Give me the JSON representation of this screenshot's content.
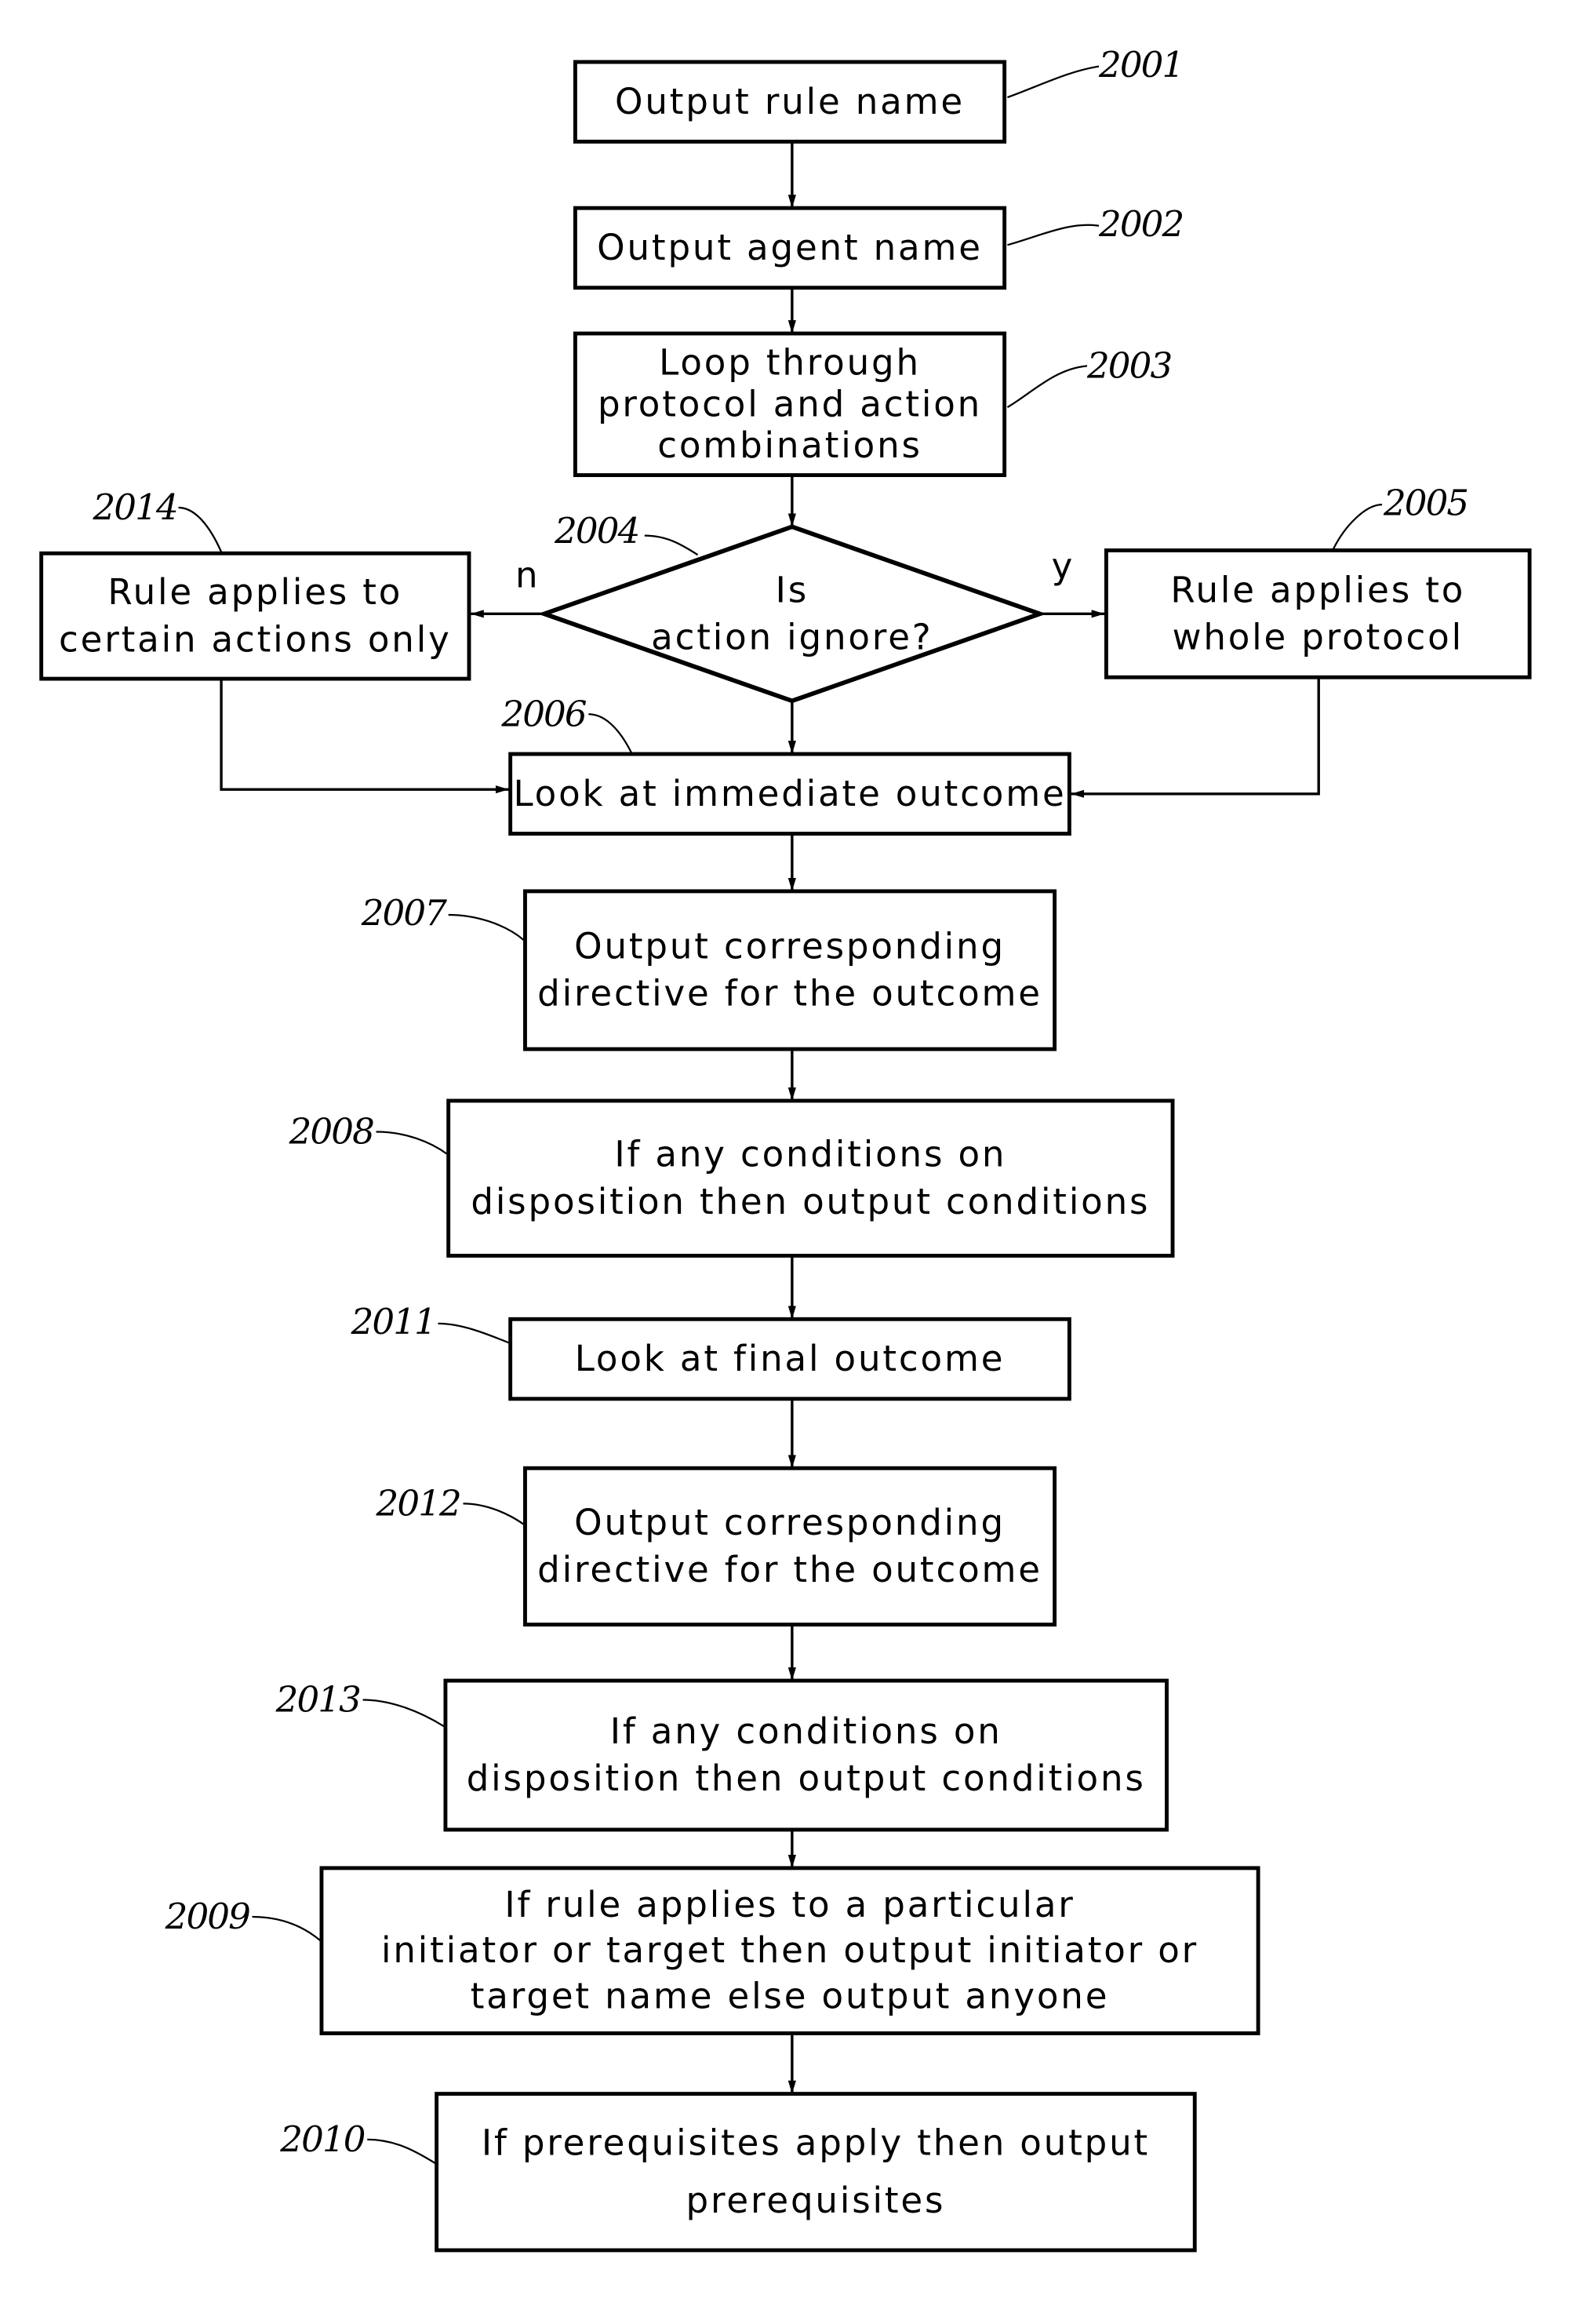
{
  "figure": {
    "type": "flowchart",
    "nodes": [
      {
        "id": "2001",
        "ref": "2001",
        "shape": "process",
        "lines": [
          "Output  rule  name"
        ]
      },
      {
        "id": "2002",
        "ref": "2002",
        "shape": "process",
        "lines": [
          "Output  agent  name"
        ]
      },
      {
        "id": "2003",
        "ref": "2003",
        "shape": "process",
        "lines": [
          "Loop  through",
          "protocol  and  action",
          "combinations"
        ]
      },
      {
        "id": "2004",
        "ref": "2004",
        "shape": "decision",
        "lines": [
          "Is",
          "action  ignore?"
        ]
      },
      {
        "id": "2014",
        "ref": "2014",
        "shape": "process",
        "lines": [
          "Rule  applies  to",
          "certain  actions  only"
        ]
      },
      {
        "id": "2005",
        "ref": "2005",
        "shape": "process",
        "lines": [
          "Rule  applies  to",
          "whole  protocol"
        ]
      },
      {
        "id": "2006",
        "ref": "2006",
        "shape": "process",
        "lines": [
          "Look  at  immediate  outcome"
        ]
      },
      {
        "id": "2007",
        "ref": "2007",
        "shape": "process",
        "lines": [
          "Output  corresponding",
          "directive  for  the  outcome"
        ]
      },
      {
        "id": "2008",
        "ref": "2008",
        "shape": "process",
        "lines": [
          "If  any  conditions  on",
          "disposition  then  output  conditions"
        ]
      },
      {
        "id": "2011",
        "ref": "2011",
        "shape": "process",
        "lines": [
          "Look  at  final  outcome"
        ]
      },
      {
        "id": "2012",
        "ref": "2012",
        "shape": "process",
        "lines": [
          "Output  corresponding",
          "directive  for  the  outcome"
        ]
      },
      {
        "id": "2013",
        "ref": "2013",
        "shape": "process",
        "lines": [
          "If  any  conditions  on",
          "disposition  then  output  conditions"
        ]
      },
      {
        "id": "2009",
        "ref": "2009",
        "shape": "process",
        "lines": [
          "If  rule  applies  to  a  particular",
          "initiator  or  target  then  output  initiator  or",
          "target  name  else  output  anyone"
        ]
      },
      {
        "id": "2010",
        "ref": "2010",
        "shape": "process",
        "lines": [
          "If  prerequisites  apply  then  output",
          "prerequisites"
        ]
      }
    ],
    "edges": [
      {
        "from": "2001",
        "to": "2002",
        "label": ""
      },
      {
        "from": "2002",
        "to": "2003",
        "label": ""
      },
      {
        "from": "2003",
        "to": "2004",
        "label": ""
      },
      {
        "from": "2004",
        "to": "2014",
        "label": "n"
      },
      {
        "from": "2004",
        "to": "2005",
        "label": "y"
      },
      {
        "from": "2004",
        "to": "2006",
        "label": ""
      },
      {
        "from": "2014",
        "to": "2006",
        "label": ""
      },
      {
        "from": "2005",
        "to": "2006",
        "label": ""
      },
      {
        "from": "2006",
        "to": "2007",
        "label": ""
      },
      {
        "from": "2007",
        "to": "2008",
        "label": ""
      },
      {
        "from": "2008",
        "to": "2011",
        "label": ""
      },
      {
        "from": "2011",
        "to": "2012",
        "label": ""
      },
      {
        "from": "2012",
        "to": "2013",
        "label": ""
      },
      {
        "from": "2013",
        "to": "2009",
        "label": ""
      },
      {
        "from": "2009",
        "to": "2010",
        "label": ""
      }
    ]
  }
}
